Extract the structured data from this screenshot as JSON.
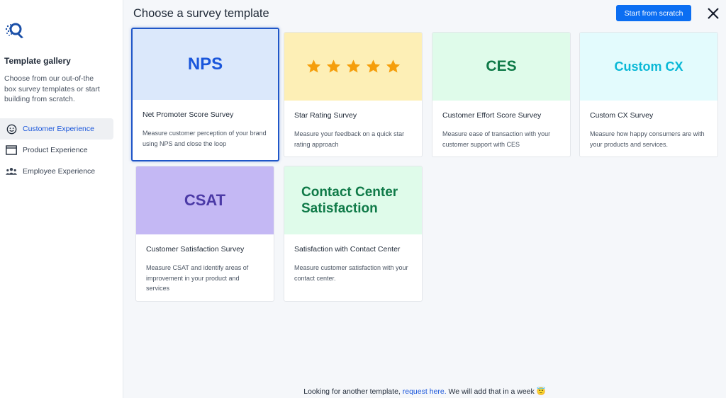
{
  "sidebar": {
    "title": "Template gallery",
    "description": "Choose from our out-of-the box survey templates or start building from scratch.",
    "items": [
      {
        "label": "Customer Experience",
        "icon": "smiley-icon",
        "active": true
      },
      {
        "label": "Product Experience",
        "icon": "window-icon",
        "active": false
      },
      {
        "label": "Employee Experience",
        "icon": "team-icon",
        "active": false
      }
    ]
  },
  "header": {
    "title": "Choose a survey template",
    "scratch_button": "Start from scratch",
    "close_icon": "close-icon"
  },
  "cards": [
    {
      "banner": "NPS",
      "title": "Net Promoter Score Survey",
      "description": "Measure customer perception of your brand using NPS and close the loop",
      "banner_bg": "#dbe8fb",
      "banner_color": "#1a56db",
      "selected": true
    },
    {
      "banner": "",
      "title": "Star Rating Survey",
      "description": "Measure your feedback on a quick star rating approach",
      "banner_bg": "#fdefb6",
      "star_color": "#f59e0b",
      "stars": 5
    },
    {
      "banner": "CES",
      "title": "Customer Effort Score Survey",
      "description": "Measure ease of transaction with your customer support with CES",
      "banner_bg": "#dffbea",
      "banner_color": "#0f7a48"
    },
    {
      "banner": "Custom CX",
      "title": "Custom CX Survey",
      "description": "Measure how happy consumers are with your products and services.",
      "banner_bg": "#e3fbfd",
      "banner_color": "#0ab8d6"
    },
    {
      "banner": "CSAT",
      "title": "Customer Satisfaction Survey",
      "description": "Measure CSAT and identify areas of improvement in your product and services",
      "banner_bg": "#c4b8f4",
      "banner_color": "#4b3aa6"
    },
    {
      "banner": "Contact Center Satisfaction",
      "title": "Satisfaction with Contact Center",
      "description": "Measure customer satisfaction with your contact center.",
      "banner_bg": "#dffbea",
      "banner_color": "#0f7a48"
    }
  ],
  "footer": {
    "text": "Looking for another template,",
    "link": "request here.",
    "suffix": "We will add that in a week 😇"
  }
}
